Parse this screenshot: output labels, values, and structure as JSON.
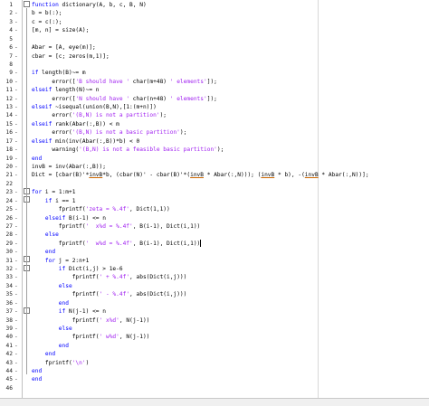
{
  "editor": {
    "lines": [
      {
        "n": "1",
        "d": "",
        "f": "box",
        "parts": [
          {
            "t": "function",
            "c": "kw"
          },
          {
            "t": " dictionary(A, b, c, B, N)",
            "c": ""
          }
        ]
      },
      {
        "n": "2",
        "d": "-",
        "f": "",
        "parts": [
          {
            "t": "b = b(:);",
            "c": ""
          }
        ]
      },
      {
        "n": "3",
        "d": "-",
        "f": "",
        "parts": [
          {
            "t": "c = c(:);",
            "c": ""
          }
        ]
      },
      {
        "n": "4",
        "d": "-",
        "f": "",
        "parts": [
          {
            "t": "[m, n] = size(A);",
            "c": ""
          }
        ]
      },
      {
        "n": "5",
        "d": "",
        "f": "",
        "parts": []
      },
      {
        "n": "6",
        "d": "-",
        "f": "",
        "parts": [
          {
            "t": "Abar = [A, eye(m)];",
            "c": ""
          }
        ]
      },
      {
        "n": "7",
        "d": "-",
        "f": "",
        "parts": [
          {
            "t": "cbar = [c; zeros(m,1)];",
            "c": ""
          }
        ]
      },
      {
        "n": "8",
        "d": "",
        "f": "",
        "parts": []
      },
      {
        "n": "9",
        "d": "-",
        "f": "",
        "parts": [
          {
            "t": "if",
            "c": "kw"
          },
          {
            "t": " length(B)~= m",
            "c": ""
          }
        ]
      },
      {
        "n": "10",
        "d": "-",
        "f": "",
        "parts": [
          {
            "t": "      error([",
            "c": ""
          },
          {
            "t": "'B should have '",
            "c": "str"
          },
          {
            "t": " char(m+48) ",
            "c": ""
          },
          {
            "t": "' elements'",
            "c": "str"
          },
          {
            "t": "]);",
            "c": ""
          }
        ]
      },
      {
        "n": "11",
        "d": "-",
        "f": "",
        "parts": [
          {
            "t": "elseif",
            "c": "kw"
          },
          {
            "t": " length(N)~= n",
            "c": ""
          }
        ]
      },
      {
        "n": "12",
        "d": "-",
        "f": "",
        "parts": [
          {
            "t": "      error([",
            "c": ""
          },
          {
            "t": "'N should have '",
            "c": "str"
          },
          {
            "t": " char(n+48) ",
            "c": ""
          },
          {
            "t": "' elements'",
            "c": "str"
          },
          {
            "t": "]);",
            "c": ""
          }
        ]
      },
      {
        "n": "13",
        "d": "-",
        "f": "",
        "parts": [
          {
            "t": "elseif",
            "c": "kw"
          },
          {
            "t": " ~isequal(union(B,N),[1:(m+n)])",
            "c": ""
          }
        ]
      },
      {
        "n": "14",
        "d": "-",
        "f": "",
        "parts": [
          {
            "t": "      error(",
            "c": ""
          },
          {
            "t": "'(B,N) is not a partition'",
            "c": "str"
          },
          {
            "t": ");",
            "c": ""
          }
        ]
      },
      {
        "n": "15",
        "d": "-",
        "f": "",
        "parts": [
          {
            "t": "elseif",
            "c": "kw"
          },
          {
            "t": " rank(Abar(:,B)) < m",
            "c": ""
          }
        ]
      },
      {
        "n": "16",
        "d": "-",
        "f": "",
        "parts": [
          {
            "t": "      error(",
            "c": ""
          },
          {
            "t": "'(B,N) is not a basic partition'",
            "c": "str"
          },
          {
            "t": ");",
            "c": ""
          }
        ]
      },
      {
        "n": "17",
        "d": "-",
        "f": "",
        "parts": [
          {
            "t": "elseif",
            "c": "kw"
          },
          {
            "t": " min(inv(Abar(:,B))*b) < 0",
            "c": ""
          }
        ]
      },
      {
        "n": "18",
        "d": "-",
        "f": "",
        "parts": [
          {
            "t": "      warning(",
            "c": ""
          },
          {
            "t": "'(B,N) is not a feasible basic partition'",
            "c": "str"
          },
          {
            "t": ");",
            "c": ""
          }
        ]
      },
      {
        "n": "19",
        "d": "-",
        "f": "",
        "parts": [
          {
            "t": "end",
            "c": "kw"
          }
        ]
      },
      {
        "n": "20",
        "d": "-",
        "f": "",
        "parts": [
          {
            "t": "invB = inv(Abar(:,B));",
            "c": ""
          }
        ]
      },
      {
        "n": "21",
        "d": "-",
        "f": "",
        "parts": [
          {
            "t": "Dict = [cbar(B)'*",
            "c": ""
          },
          {
            "t": "invB",
            "c": "ul"
          },
          {
            "t": "*b, (cbar(N)' - cbar(B)'*(",
            "c": ""
          },
          {
            "t": "invB",
            "c": "ul"
          },
          {
            "t": " * Abar(:,N))); (",
            "c": ""
          },
          {
            "t": "invB",
            "c": "ul"
          },
          {
            "t": " * b), -(",
            "c": ""
          },
          {
            "t": "invB",
            "c": "ul"
          },
          {
            "t": " * Abar(:,N))];",
            "c": ""
          }
        ]
      },
      {
        "n": "22",
        "d": "",
        "f": "",
        "parts": []
      },
      {
        "n": "23",
        "d": "-",
        "f": "box",
        "parts": [
          {
            "t": "for",
            "c": "kw"
          },
          {
            "t": " i = 1:m+1",
            "c": ""
          }
        ]
      },
      {
        "n": "24",
        "d": "-",
        "f": "box",
        "parts": [
          {
            "t": "    if",
            "c": "kw"
          },
          {
            "t": " i == 1",
            "c": ""
          }
        ]
      },
      {
        "n": "25",
        "d": "-",
        "f": "",
        "parts": [
          {
            "t": "        fprintf(",
            "c": ""
          },
          {
            "t": "'zeta = %.4f'",
            "c": "str"
          },
          {
            "t": ", Dict(1,1))",
            "c": ""
          }
        ]
      },
      {
        "n": "26",
        "d": "-",
        "f": "",
        "parts": [
          {
            "t": "    elseif",
            "c": "kw"
          },
          {
            "t": " B(i-1) <= n",
            "c": ""
          }
        ]
      },
      {
        "n": "27",
        "d": "-",
        "f": "",
        "parts": [
          {
            "t": "        fprintf(",
            "c": ""
          },
          {
            "t": "'  x%d = %.4f'",
            "c": "str"
          },
          {
            "t": ", B(i-1), Dict(i,1))",
            "c": ""
          }
        ]
      },
      {
        "n": "28",
        "d": "-",
        "f": "",
        "parts": [
          {
            "t": "    else",
            "c": "kw"
          }
        ]
      },
      {
        "n": "29",
        "d": "-",
        "f": "",
        "parts": [
          {
            "t": "        fprintf(",
            "c": ""
          },
          {
            "t": "'  w%d = %.4f'",
            "c": "str"
          },
          {
            "t": ", B(i-1), Dict(i,1))",
            "c": ""
          },
          {
            "t": "|",
            "c": "cursor"
          }
        ]
      },
      {
        "n": "30",
        "d": "-",
        "f": "",
        "parts": [
          {
            "t": "    end",
            "c": "kw"
          }
        ]
      },
      {
        "n": "31",
        "d": "-",
        "f": "box",
        "parts": [
          {
            "t": "    for",
            "c": "kw"
          },
          {
            "t": " j = 2:n+1",
            "c": ""
          }
        ]
      },
      {
        "n": "32",
        "d": "-",
        "f": "box",
        "parts": [
          {
            "t": "        if",
            "c": "kw"
          },
          {
            "t": " Dict(i,j) > 1e-6",
            "c": ""
          }
        ]
      },
      {
        "n": "33",
        "d": "-",
        "f": "",
        "parts": [
          {
            "t": "            fprintf(",
            "c": ""
          },
          {
            "t": "' + %.4f'",
            "c": "str"
          },
          {
            "t": ", abs(Dict(i,j)))",
            "c": ""
          }
        ]
      },
      {
        "n": "34",
        "d": "-",
        "f": "",
        "parts": [
          {
            "t": "        else",
            "c": "kw"
          }
        ]
      },
      {
        "n": "35",
        "d": "-",
        "f": "",
        "parts": [
          {
            "t": "            fprintf(",
            "c": ""
          },
          {
            "t": "' - %.4f'",
            "c": "str"
          },
          {
            "t": ", abs(Dict(i,j)))",
            "c": ""
          }
        ]
      },
      {
        "n": "36",
        "d": "-",
        "f": "",
        "parts": [
          {
            "t": "        end",
            "c": "kw"
          }
        ]
      },
      {
        "n": "37",
        "d": "-",
        "f": "box",
        "parts": [
          {
            "t": "        if",
            "c": "kw"
          },
          {
            "t": " N(j-1) <= n",
            "c": ""
          }
        ]
      },
      {
        "n": "38",
        "d": "-",
        "f": "",
        "parts": [
          {
            "t": "            fprintf(",
            "c": ""
          },
          {
            "t": "' x%d'",
            "c": "str"
          },
          {
            "t": ", N(j-1))",
            "c": ""
          }
        ]
      },
      {
        "n": "39",
        "d": "-",
        "f": "",
        "parts": [
          {
            "t": "        else",
            "c": "kw"
          }
        ]
      },
      {
        "n": "40",
        "d": "-",
        "f": "",
        "parts": [
          {
            "t": "            fprintf(",
            "c": ""
          },
          {
            "t": "' w%d'",
            "c": "str"
          },
          {
            "t": ", N(j-1))",
            "c": ""
          }
        ]
      },
      {
        "n": "41",
        "d": "-",
        "f": "",
        "parts": [
          {
            "t": "        end",
            "c": "kw"
          }
        ]
      },
      {
        "n": "42",
        "d": "-",
        "f": "",
        "parts": [
          {
            "t": "    end",
            "c": "kw"
          }
        ]
      },
      {
        "n": "43",
        "d": "-",
        "f": "",
        "parts": [
          {
            "t": "    fprintf(",
            "c": ""
          },
          {
            "t": "'\\n'",
            "c": "str"
          },
          {
            "t": ")",
            "c": ""
          }
        ]
      },
      {
        "n": "44",
        "d": "-",
        "f": "",
        "parts": [
          {
            "t": "end",
            "c": "kw"
          }
        ]
      },
      {
        "n": "45",
        "d": "-",
        "f": "",
        "parts": [
          {
            "t": "end",
            "c": "kw"
          }
        ]
      },
      {
        "n": "46",
        "d": "",
        "f": "",
        "parts": []
      }
    ]
  }
}
